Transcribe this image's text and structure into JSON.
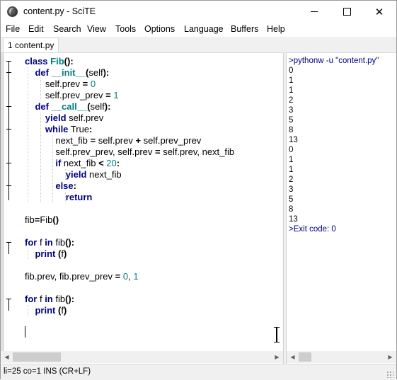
{
  "window": {
    "title": "content.py - SciTE"
  },
  "menu": [
    "File",
    "Edit",
    "Search",
    "View",
    "Tools",
    "Options",
    "Language",
    "Buffers",
    "Help"
  ],
  "tabs": [
    {
      "label": "1 content.py"
    }
  ],
  "editor": {
    "lines": [
      [
        [
          "kw",
          "class"
        ],
        [
          "t",
          " "
        ],
        [
          "fn",
          "Fib"
        ],
        [
          "op",
          "():"
        ]
      ],
      [
        [
          "t",
          "    "
        ],
        [
          "kw",
          "def"
        ],
        [
          "t",
          " "
        ],
        [
          "fn",
          "__init__"
        ],
        [
          "op",
          "("
        ],
        [
          "t",
          "self"
        ],
        [
          "op",
          "):"
        ]
      ],
      [
        [
          "t",
          "        self.prev "
        ],
        [
          "op",
          "="
        ],
        [
          "t",
          " "
        ],
        [
          "num",
          "0"
        ]
      ],
      [
        [
          "t",
          "        self.prev_prev "
        ],
        [
          "op",
          "="
        ],
        [
          "t",
          " "
        ],
        [
          "num",
          "1"
        ]
      ],
      [
        [
          "t",
          "    "
        ],
        [
          "kw",
          "def"
        ],
        [
          "t",
          " "
        ],
        [
          "fn",
          "__call__"
        ],
        [
          "op",
          "("
        ],
        [
          "t",
          "self"
        ],
        [
          "op",
          "):"
        ]
      ],
      [
        [
          "t",
          "        "
        ],
        [
          "kw",
          "yield"
        ],
        [
          "t",
          " self.prev"
        ]
      ],
      [
        [
          "t",
          "        "
        ],
        [
          "kw",
          "while"
        ],
        [
          "t",
          " True"
        ],
        [
          "op",
          ":"
        ]
      ],
      [
        [
          "t",
          "            next_fib "
        ],
        [
          "op",
          "="
        ],
        [
          "t",
          " self.prev "
        ],
        [
          "op",
          "+"
        ],
        [
          "t",
          " self.prev_prev"
        ]
      ],
      [
        [
          "t",
          "            self.prev_prev, self.prev "
        ],
        [
          "op",
          "="
        ],
        [
          "t",
          " self.prev, next_fib"
        ]
      ],
      [
        [
          "t",
          "            "
        ],
        [
          "kw",
          "if"
        ],
        [
          "t",
          " next_fib "
        ],
        [
          "op",
          "<"
        ],
        [
          "t",
          " "
        ],
        [
          "num",
          "20"
        ],
        [
          "op",
          ":"
        ]
      ],
      [
        [
          "t",
          "                "
        ],
        [
          "kw",
          "yield"
        ],
        [
          "t",
          " next_fib"
        ]
      ],
      [
        [
          "t",
          "            "
        ],
        [
          "kw",
          "else"
        ],
        [
          "op",
          ":"
        ]
      ],
      [
        [
          "t",
          "                "
        ],
        [
          "kw",
          "return"
        ]
      ],
      [],
      [
        [
          "t",
          "fib"
        ],
        [
          "op",
          "="
        ],
        [
          "t",
          "Fib"
        ],
        [
          "op",
          "()"
        ]
      ],
      [],
      [
        [
          "kw",
          "for"
        ],
        [
          "t",
          " f "
        ],
        [
          "kw",
          "in"
        ],
        [
          "t",
          " fib"
        ],
        [
          "op",
          "():"
        ]
      ],
      [
        [
          "t",
          "    "
        ],
        [
          "kw",
          "print"
        ],
        [
          "t",
          " "
        ],
        [
          "op",
          "("
        ],
        [
          "t",
          "f"
        ],
        [
          "op",
          ")"
        ]
      ],
      [],
      [
        [
          "t",
          "fib.prev, fib.prev_prev "
        ],
        [
          "op",
          "="
        ],
        [
          "t",
          " "
        ],
        [
          "num",
          "0"
        ],
        [
          "t",
          ", "
        ],
        [
          "num",
          "1"
        ]
      ],
      [],
      [
        [
          "kw",
          "for"
        ],
        [
          "t",
          " f "
        ],
        [
          "kw",
          "in"
        ],
        [
          "t",
          " fib"
        ],
        [
          "op",
          "():"
        ]
      ],
      [
        [
          "t",
          "    "
        ],
        [
          "kw",
          "print"
        ],
        [
          "t",
          " "
        ],
        [
          "op",
          "("
        ],
        [
          "t",
          "f"
        ],
        [
          "op",
          ")"
        ]
      ],
      [],
      []
    ]
  },
  "output": {
    "command": ">pythonw -u \"content.py\"",
    "values": [
      "0",
      "1",
      "1",
      "2",
      "3",
      "5",
      "8",
      "13",
      "0",
      "1",
      "1",
      "2",
      "3",
      "5",
      "8",
      "13"
    ],
    "exit": ">Exit code: 0"
  },
  "status": {
    "text": "li=25 co=1 INS (CR+LF)"
  },
  "colors": {
    "keyword": "#00007f",
    "function": "#007f7f",
    "number": "#007f7f"
  }
}
